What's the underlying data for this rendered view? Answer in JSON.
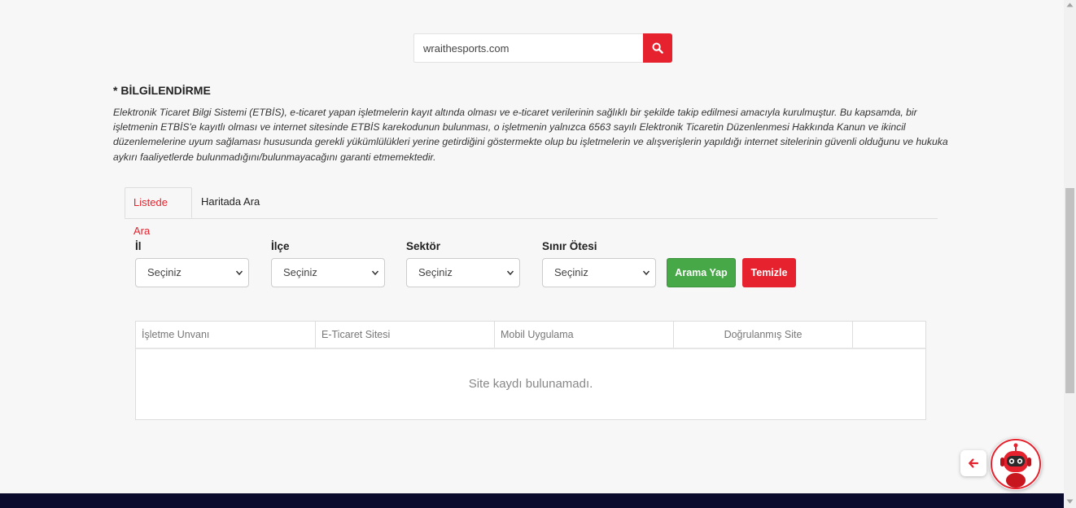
{
  "search": {
    "value": "wraithesports.com",
    "button_icon": "search-icon"
  },
  "info": {
    "title": "* BİLGİLENDİRME",
    "text": "Elektronik Ticaret Bilgi Sistemi (ETBİS), e-ticaret yapan işletmelerin kayıt altında olması ve e-ticaret verilerinin sağlıklı bir şekilde takip edilmesi amacıyla kurulmuştur. Bu kapsamda, bir işletmenin ETBİS'e kayıtlı olması ve internet sitesinde ETBİS karekodunun bulunması, o işletmenin yalnızca 6563 sayılı Elektronik Ticaretin Düzenlenmesi Hakkında Kanun ve ikincil düzenlemelerine uyum sağlaması hususunda gerekli yükümlülükleri yerine getirdiğini göstermekte olup bu işletmelerin ve alışverişlerin yapıldığı internet sitelerinin güvenli olduğunu ve hukuka aykırı faaliyetlerde bulunmadığını/bulunmayacağını garanti etmemektedir."
  },
  "tabs": [
    {
      "label": "Listede Ara",
      "active": true
    },
    {
      "label": "Haritada Ara",
      "active": false
    }
  ],
  "filters": [
    {
      "label": "İl",
      "value": "Seçiniz"
    },
    {
      "label": "İlçe",
      "value": "Seçiniz"
    },
    {
      "label": "Sektör",
      "value": "Seçiniz"
    },
    {
      "label": "Sınır Ötesi",
      "value": "Seçiniz"
    }
  ],
  "buttons": {
    "search_label": "Arama Yap",
    "clear_label": "Temizle"
  },
  "table": {
    "columns": [
      "İşletme Unvanı",
      "E-Ticaret Sitesi",
      "Mobil Uygulama",
      "Doğrulanmış Site",
      ""
    ],
    "empty_message": "Site kaydı bulunamadı."
  },
  "colors": {
    "accent_red": "#e5222d",
    "success_green": "#46a846",
    "footer_navy": "#0b0c2d"
  }
}
